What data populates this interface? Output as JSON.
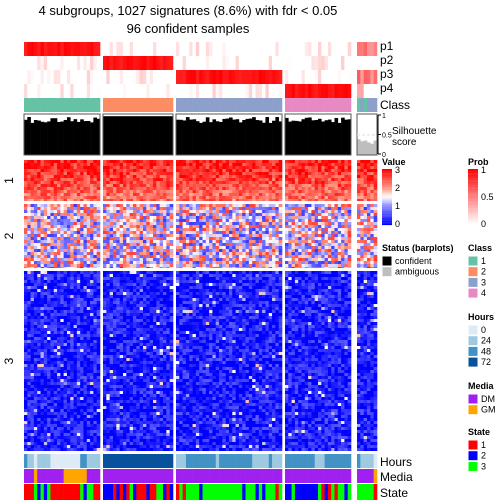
{
  "chart_data": {
    "type": "heatmap",
    "title": "4 subgroups, 1027 signatures (8.6%) with fdr < 0.05",
    "subtitle": "96 confident samples",
    "column_groups": [
      {
        "class": "1",
        "n": 23
      },
      {
        "class": "2",
        "n": 21
      },
      {
        "class": "3",
        "n": 32
      },
      {
        "class": "4",
        "n": 20
      },
      {
        "class": "ambiguous",
        "n": 6
      }
    ],
    "row_groups": [
      {
        "label": "1",
        "level": 2.8
      },
      {
        "label": "2",
        "level": 1.5
      },
      {
        "label": "3",
        "level": 0.2
      }
    ],
    "annotation_labels": {
      "p1": "p1",
      "p2": "p2",
      "p3": "p3",
      "p4": "p4",
      "class": "Class",
      "silhouette": "Silhouette\nscore",
      "hours": "Hours",
      "media": "Media",
      "state": "State"
    },
    "silhouette_ticks": [
      "0",
      "0.5",
      "1"
    ],
    "hours": [
      [
        48,
        24,
        24,
        0,
        24,
        24,
        24,
        24,
        0,
        0,
        0,
        0,
        0,
        0,
        0,
        0,
        0,
        48,
        48,
        24,
        24,
        24,
        24
      ],
      [
        72,
        72,
        72,
        72,
        72,
        72,
        72,
        72,
        72,
        72,
        72,
        72,
        72,
        72,
        72,
        72,
        72,
        72,
        72,
        72,
        72
      ],
      [
        24,
        24,
        24,
        48,
        48,
        48,
        48,
        48,
        48,
        48,
        48,
        48,
        24,
        48,
        48,
        48,
        48,
        48,
        48,
        48,
        48,
        48,
        48,
        24,
        24,
        24,
        24,
        24,
        48,
        24,
        24,
        24
      ],
      [
        48,
        48,
        48,
        48,
        48,
        48,
        48,
        48,
        48,
        24,
        24,
        24,
        48,
        48,
        48,
        48,
        48,
        48,
        48,
        48,
        24
      ],
      [
        48,
        24,
        24,
        24,
        24,
        0
      ]
    ],
    "media": [
      [
        "DM",
        "DM",
        "DM",
        "GM",
        "DM",
        "DM",
        "DM",
        "DM",
        "DM",
        "DM",
        "DM",
        "DM",
        "GM",
        "GM",
        "GM",
        "GM",
        "GM",
        "GM",
        "GM",
        "DM",
        "DM",
        "DM",
        "DM"
      ],
      [
        "DM"
      ],
      [
        "DM"
      ],
      [
        "DM"
      ],
      [
        "DM",
        "DM",
        "DM",
        "DM",
        "DM",
        "GM"
      ]
    ],
    "state": [
      [
        1,
        1,
        1,
        3,
        2,
        3,
        2,
        3,
        1,
        1,
        1,
        1,
        1,
        1,
        1,
        1,
        1,
        3,
        2,
        3,
        3,
        1,
        1
      ],
      [
        2,
        2,
        2,
        1,
        2,
        1,
        2,
        1,
        3,
        2,
        1,
        1,
        1,
        2,
        1,
        1,
        3,
        3,
        2,
        1,
        2
      ],
      [
        1,
        3,
        1,
        3,
        3,
        3,
        3,
        2,
        3,
        3,
        3,
        3,
        3,
        3,
        3,
        3,
        3,
        3,
        3,
        3,
        2,
        3,
        3,
        3,
        2,
        3,
        2,
        3,
        3,
        3,
        1,
        3
      ],
      [
        2,
        2,
        3,
        2,
        2,
        2,
        2,
        2,
        2,
        2,
        3,
        1,
        2,
        1,
        3,
        1,
        3,
        3,
        2,
        3
      ],
      [
        3,
        3,
        3,
        3,
        3,
        1
      ]
    ],
    "legends": {
      "value": {
        "title": "Value",
        "ticks": [
          "3",
          "2",
          "1",
          "0"
        ]
      },
      "prob": {
        "title": "Prob",
        "ticks": [
          "1",
          "0.5",
          "0"
        ]
      },
      "status": {
        "title": "Status (barplots)",
        "items": [
          {
            "label": "confident",
            "color": "#000000"
          },
          {
            "label": "ambiguous",
            "color": "#BEBEBE"
          }
        ]
      },
      "class": {
        "title": "Class",
        "items": [
          {
            "label": "1",
            "color": "#66C2A5"
          },
          {
            "label": "2",
            "color": "#FC8D62"
          },
          {
            "label": "3",
            "color": "#8DA0CB"
          },
          {
            "label": "4",
            "color": "#E78AC3"
          }
        ]
      },
      "hours": {
        "title": "Hours",
        "items": [
          {
            "label": "0",
            "color": "#DEEBF7"
          },
          {
            "label": "24",
            "color": "#9ECAE1"
          },
          {
            "label": "48",
            "color": "#4292C6"
          },
          {
            "label": "72",
            "color": "#08519C"
          }
        ]
      },
      "media": {
        "title": "Media",
        "items": [
          {
            "label": "DM",
            "color": "#A020F0"
          },
          {
            "label": "GM",
            "color": "#FFA500"
          }
        ]
      },
      "state": {
        "title": "State",
        "items": [
          {
            "label": "1",
            "color": "#FF0000"
          },
          {
            "label": "2",
            "color": "#0000FF"
          },
          {
            "label": "3",
            "color": "#00FF00"
          }
        ]
      }
    }
  }
}
